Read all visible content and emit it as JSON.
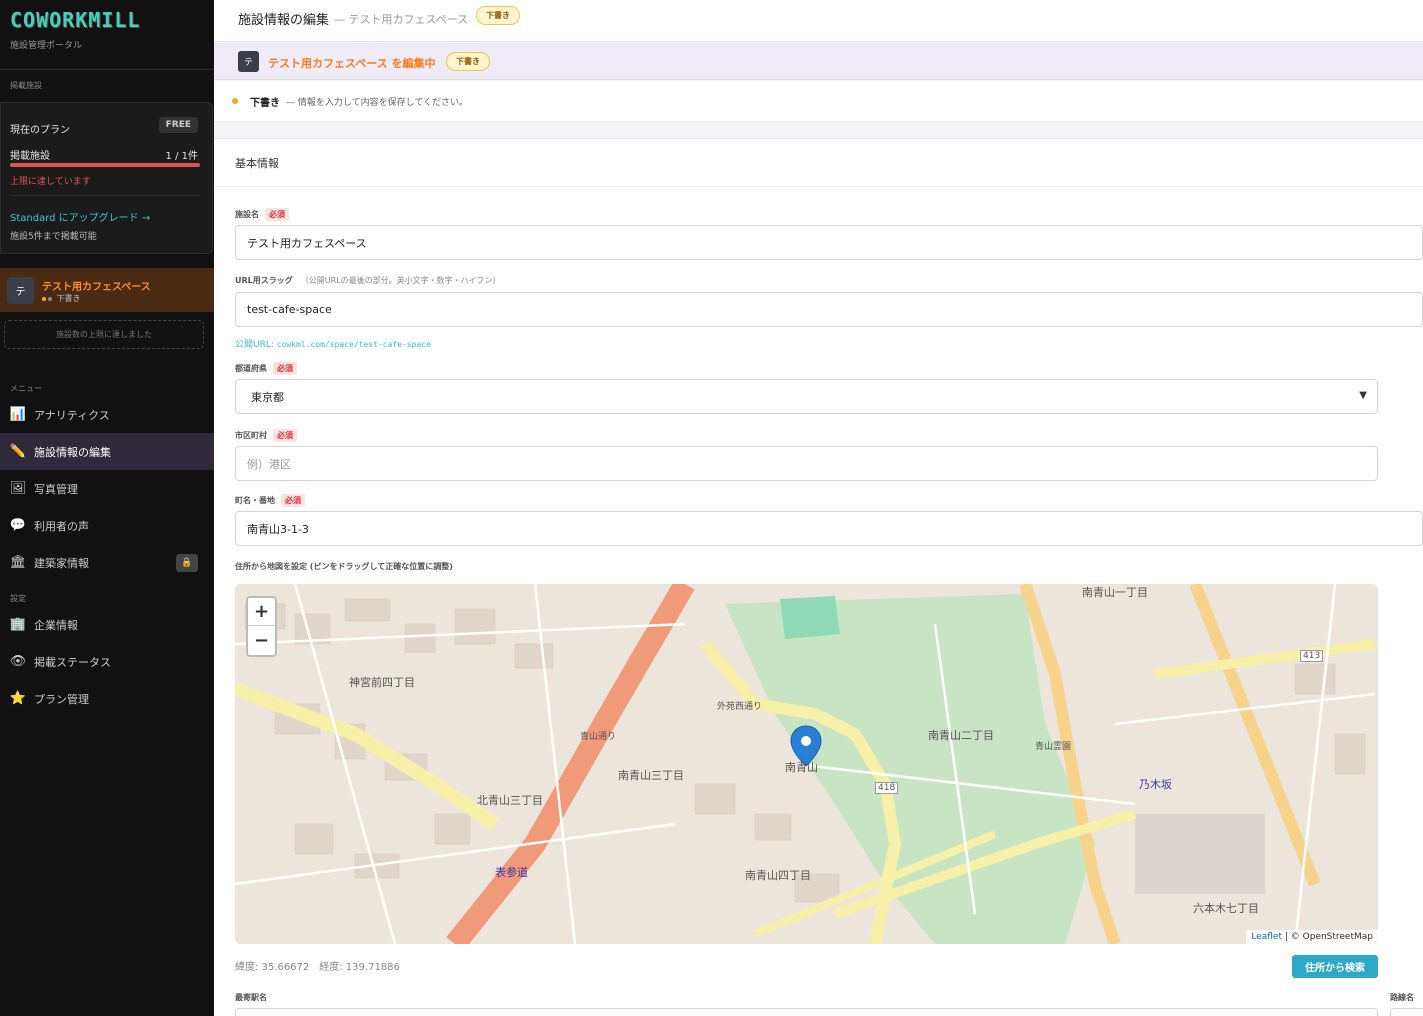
{
  "sidebar": {
    "logo": "COWORKMILL",
    "logo_sub": "施設管理ポータル",
    "listed_section": "掲載施設",
    "plan": {
      "label": "現在のプラン",
      "badge": "FREE",
      "listed_label": "掲載施設",
      "listed_count": "1 / 1件",
      "usage_fraction": 1.0,
      "limit_text": "上限に達しています",
      "upgrade_link": "Standard にアップグレード →",
      "upgrade_sub": "施設5件まで掲載可能"
    },
    "facility": {
      "avatar": "テ",
      "name": "テスト用カフェスペース",
      "status": "下書き"
    },
    "limit_notice": "施設数の上限に達しました",
    "menu_section": "メニュー",
    "menu": [
      {
        "label": "アナリティクス",
        "icon": "bar-chart-icon"
      },
      {
        "label": "施設情報の編集",
        "icon": "pencil-icon"
      },
      {
        "label": "写真管理",
        "icon": "photo-icon"
      },
      {
        "label": "利用者の声",
        "icon": "speech-bubble-icon"
      },
      {
        "label": "建築家情報",
        "icon": "building-icon"
      }
    ],
    "settings_section": "設定",
    "settings": [
      {
        "label": "企業情報",
        "icon": "office-icon"
      },
      {
        "label": "掲載ステータス",
        "icon": "eye-icon"
      },
      {
        "label": "プラン管理",
        "icon": "star-icon"
      }
    ]
  },
  "header": {
    "title": "施設情報の編集",
    "subtitle": "— テスト用カフェスペース",
    "badge": "下書き"
  },
  "banner": {
    "avatar": "テ",
    "text": "テスト用カフェスペース を編集中",
    "badge": "下書き"
  },
  "status": {
    "strong": "下書き",
    "text": "— 情報を入力して内容を保存してください。"
  },
  "form": {
    "section_title": "基本情報",
    "required_label": "必須",
    "name_label": "施設名",
    "name_value": "テスト用カフェスペース",
    "slug_label": "URL用スラッグ",
    "slug_hint": "（公開URLの最後の部分。英小文字・数字・ハイフン）",
    "slug_value": "test-cafe-space",
    "public_url_prefix": "公開URL:",
    "public_url": "cowkml.com/space/test-cafe-space",
    "prefecture_label": "都道府県",
    "prefecture_value": "東京都",
    "city_label": "市区町村",
    "city_placeholder": "例）港区",
    "address_label": "町名・番地",
    "address_value": "南青山3-1-3",
    "map_label": "住所から地図を設定 (ピンをドラッグして正確な位置に調整)",
    "coords": "緯度: 35.66672　経度: 139.71886",
    "search_button": "住所から検索",
    "station_label": "最寄駅名",
    "line_label": "路線名"
  },
  "map": {
    "zoom_in": "+",
    "zoom_out": "−",
    "attribution_leaflet": "Leaflet",
    "attribution_osm": "| © OpenStreetMap",
    "labels": [
      "神宮前四丁目",
      "北青山三丁目",
      "南青山三丁目",
      "南青山",
      "南青山二丁目",
      "南青山四丁目",
      "表参道",
      "南青山一丁目",
      "乃木坂",
      "六本木七丁目",
      "青山霊園",
      "外苑西通り",
      "青山通り",
      "418",
      "413"
    ]
  }
}
